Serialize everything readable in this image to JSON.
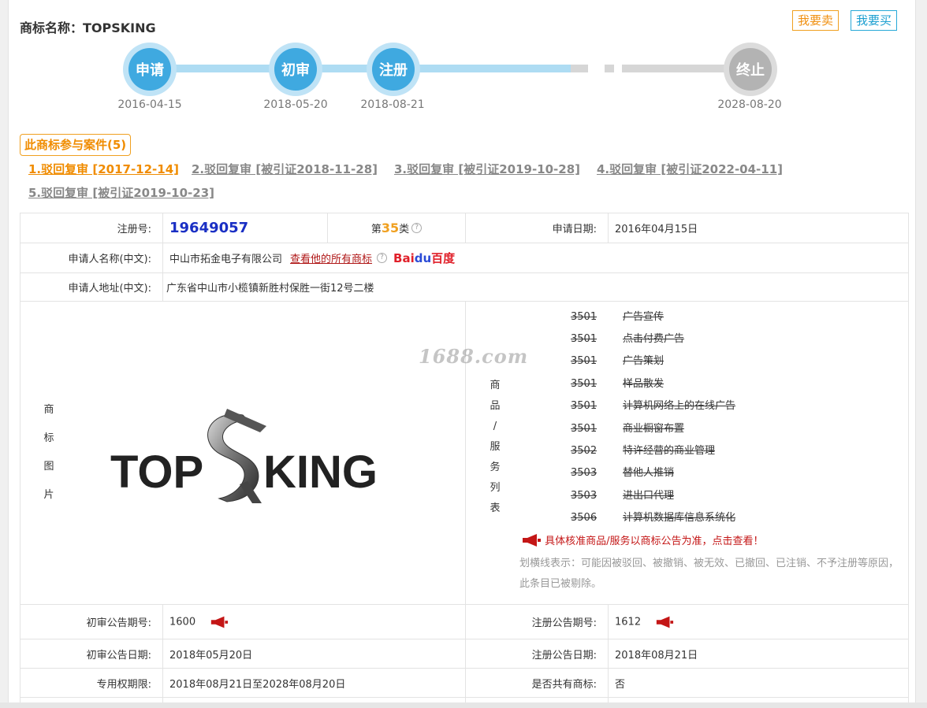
{
  "header": {
    "title_label": "商标名称：",
    "title_value": "TOPSKING",
    "sell_button": "我要卖",
    "buy_button": "我要买"
  },
  "timeline": [
    {
      "label": "申请",
      "date": "2016-04-15"
    },
    {
      "label": "初审",
      "date": "2018-05-20"
    },
    {
      "label": "注册",
      "date": "2018-08-21"
    },
    {
      "label": "终止",
      "date": "2028-08-20"
    }
  ],
  "cases": {
    "badge": "此商标参与案件(5)",
    "links": [
      "1.驳回复审 [2017-12-14]",
      "2.驳回复审 [被引证2018-11-28]",
      "3.驳回复审 [被引证2019-10-28]",
      "4.驳回复审 [被引证2022-04-11]",
      "5.驳回复审 [被引证2019-10-23]"
    ]
  },
  "info": {
    "reg_no_label": "注册号:",
    "reg_no": "19649057",
    "class_prefix": "第",
    "class_num": "35",
    "class_suffix": "类",
    "apply_date_label": "申请日期:",
    "apply_date": "2016年04月15日",
    "applicant_label": "申请人名称(中文):",
    "applicant": "中山市拓金电子有限公司",
    "all_marks_link": "查看他的所有商标",
    "baidu_b": "Bai",
    "baidu_du": "du",
    "baidu_cn": "百度",
    "address_label": "申请人地址(中文):",
    "address": "广东省中山市小榄镇新胜村保胜一街12号二楼",
    "image_label_chars": [
      "商",
      "标",
      "图",
      "片"
    ],
    "goods_label_chars": [
      "商",
      "品",
      "/",
      "服",
      "务",
      "列",
      "表"
    ],
    "logo_left": "TOP",
    "logo_right": "KING",
    "watermark": "1688.com",
    "goods": [
      {
        "code": "3501",
        "name": "广告宣传"
      },
      {
        "code": "3501",
        "name": "点击付费广告"
      },
      {
        "code": "3501",
        "name": "广告策划"
      },
      {
        "code": "3501",
        "name": "样品散发"
      },
      {
        "code": "3501",
        "name": "计算机网络上的在线广告"
      },
      {
        "code": "3501",
        "name": "商业橱窗布置"
      },
      {
        "code": "3502",
        "name": "特许经营的商业管理"
      },
      {
        "code": "3503",
        "name": "替他人推销"
      },
      {
        "code": "3503",
        "name": "进出口代理"
      },
      {
        "code": "3506",
        "name": "计算机数据库信息系统化"
      }
    ],
    "goods_notice": "具体核准商品/服务以商标公告为准，点击查看！",
    "strike_note": "划横线表示：可能因被驳回、被撤销、被无效、已撤回、已注销、不予注册等原因，此条目已被剔除。",
    "prelim_no_label": "初审公告期号:",
    "prelim_no": "1600",
    "reg_pub_no_label": "注册公告期号:",
    "reg_pub_no": "1612",
    "prelim_date_label": "初审公告日期:",
    "prelim_date": "2018年05月20日",
    "reg_pub_date_label": "注册公告日期:",
    "reg_pub_date": "2018年08月21日",
    "exclusive_label": "专用权期限:",
    "exclusive": "2018年08月21日至2028年08月20日",
    "shared_label": "是否共有商标:",
    "shared": "否"
  },
  "colors": {
    "accent_orange": "#f08c00",
    "timeline_blue": "#3fa9e0",
    "timeline_gray": "#b3b3b3",
    "reg_no_blue": "#1a2fc4",
    "notice_red": "#c41616"
  }
}
